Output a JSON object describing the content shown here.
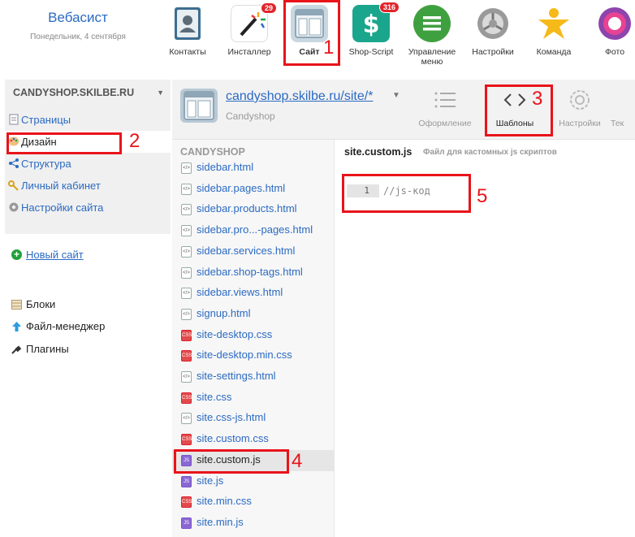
{
  "brand": {
    "name": "Вебасист",
    "date": "Понедельник, 4 сентября"
  },
  "apps": [
    {
      "label": "Контакты",
      "icon": "contacts-icon"
    },
    {
      "label": "Инсталлер",
      "icon": "installer-icon",
      "badge": "29"
    },
    {
      "label": "Сайт",
      "icon": "site-icon"
    },
    {
      "label": "Shop-Script",
      "icon": "shop-script-icon",
      "badge": "316"
    },
    {
      "label": "Управление меню",
      "icon": "menu-manager-icon"
    },
    {
      "label": "Настройки",
      "icon": "settings-icon"
    },
    {
      "label": "Команда",
      "icon": "team-icon"
    },
    {
      "label": "Фото",
      "icon": "photo-icon"
    }
  ],
  "sidebar": {
    "site": "CANDYSHOP.SKILBE.RU",
    "items": [
      {
        "label": "Страницы",
        "icon": "pages-icon"
      },
      {
        "label": "Дизайн",
        "icon": "palette-icon"
      },
      {
        "label": "Структура",
        "icon": "structure-icon"
      },
      {
        "label": "Личный кабинет",
        "icon": "key-icon"
      },
      {
        "label": "Настройки сайта",
        "icon": "gear-icon"
      }
    ],
    "new_site": "Новый сайт",
    "extras": [
      {
        "label": "Блоки",
        "icon": "blocks-icon"
      },
      {
        "label": "Файл-менеджер",
        "icon": "upload-arrow-icon"
      },
      {
        "label": "Плагины",
        "icon": "plug-icon"
      }
    ]
  },
  "header": {
    "url": "candyshop.skilbe.ru/site/*",
    "subtitle": "Candyshop",
    "tabs": [
      {
        "label": "Оформление"
      },
      {
        "label": "Шаблоны"
      },
      {
        "label": "Настройки"
      },
      {
        "label": "Тек"
      }
    ]
  },
  "files": {
    "title": "CANDYSHOP",
    "list": [
      {
        "name": "sidebar.html",
        "type": "html"
      },
      {
        "name": "sidebar.pages.html",
        "type": "html"
      },
      {
        "name": "sidebar.products.html",
        "type": "html"
      },
      {
        "name": "sidebar.pro...-pages.html",
        "type": "html"
      },
      {
        "name": "sidebar.services.html",
        "type": "html"
      },
      {
        "name": "sidebar.shop-tags.html",
        "type": "html"
      },
      {
        "name": "sidebar.views.html",
        "type": "html"
      },
      {
        "name": "signup.html",
        "type": "html"
      },
      {
        "name": "site-desktop.css",
        "type": "css"
      },
      {
        "name": "site-desktop.min.css",
        "type": "css"
      },
      {
        "name": "site-settings.html",
        "type": "html"
      },
      {
        "name": "site.css",
        "type": "css"
      },
      {
        "name": "site.css-js.html",
        "type": "html"
      },
      {
        "name": "site.custom.css",
        "type": "css"
      },
      {
        "name": "site.custom.js",
        "type": "js"
      },
      {
        "name": "site.js",
        "type": "js"
      },
      {
        "name": "site.min.css",
        "type": "css"
      },
      {
        "name": "site.min.js",
        "type": "js"
      }
    ]
  },
  "editor": {
    "filename": "site.custom.js",
    "description": "Файл для кастомных js скриптов",
    "line_number": "1",
    "code": "//js-код"
  },
  "callouts": [
    "1",
    "2",
    "3",
    "4",
    "5"
  ],
  "colors": {
    "link": "#2b6ac2",
    "annotation": "#e8141a",
    "sidebar_bg": "#f0f0f0"
  }
}
